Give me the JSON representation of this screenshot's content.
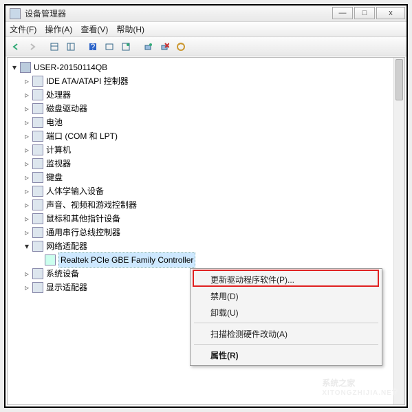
{
  "titlebar": {
    "title": "设备管理器"
  },
  "window_buttons": {
    "minimize": "—",
    "maximize": "□",
    "close": "x"
  },
  "menubar": {
    "file": "文件(F)",
    "action": "操作(A)",
    "view": "查看(V)",
    "help": "帮助(H)"
  },
  "tree": {
    "root": "USER-20150114QB",
    "items": [
      "IDE ATA/ATAPI 控制器",
      "处理器",
      "磁盘驱动器",
      "电池",
      "端口 (COM 和 LPT)",
      "计算机",
      "监视器",
      "键盘",
      "人体学输入设备",
      "声音、视频和游戏控制器",
      "鼠标和其他指针设备",
      "通用串行总线控制器",
      "网络适配器",
      "系统设备",
      "显示适配器"
    ],
    "expanded_index": 12,
    "expanded_children": [
      "Realtek PCIe GBE Family Controller"
    ]
  },
  "context_menu": {
    "update": "更新驱动程序软件(P)...",
    "disable": "禁用(D)",
    "uninstall": "卸载(U)",
    "scan": "扫描检测硬件改动(A)",
    "properties": "属性(R)"
  },
  "watermark": {
    "brand": "系统之家",
    "url": "XITONGZHIJIA.NET"
  }
}
